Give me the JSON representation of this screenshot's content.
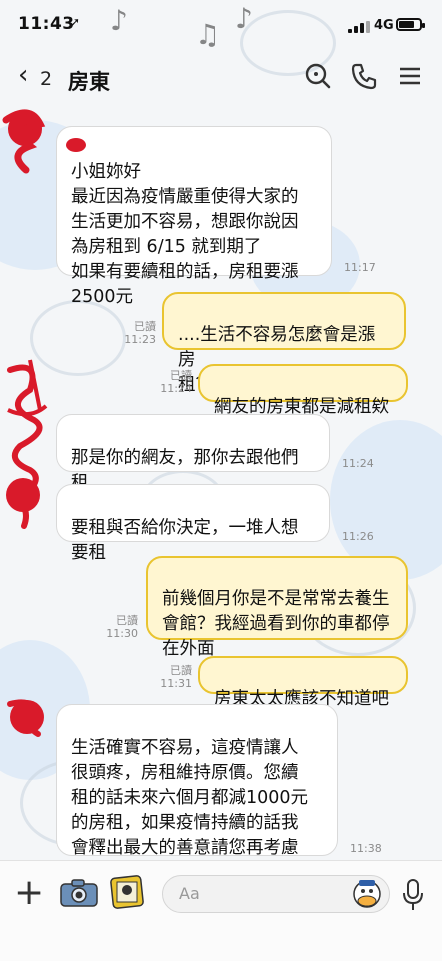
{
  "status": {
    "time": "11:43",
    "network": "4G"
  },
  "header": {
    "back_icon": "chevron-left-icon",
    "unread_count": "2",
    "title": "房東"
  },
  "messages": [
    {
      "text": "小姐妳好\n最近因為疫情嚴重使得大家的\n生活更加不容易，想跟你說因\n為房租到 6/15 就到期了\n如果有要續租的話，房租要漲\n2500元",
      "time": "11:17"
    },
    {
      "text": "....生活不容易怎麼會是漲房\n租？",
      "read": "已讀",
      "time": "11:23"
    },
    {
      "text": "網友的房東都是減租欸",
      "read": "已讀",
      "time": "11:24"
    },
    {
      "text": "那是你的網友，那你去跟他們\n租",
      "time": "11:24"
    },
    {
      "text": "要租與否給你決定，一堆人想\n要租",
      "time": "11:26"
    },
    {
      "text": "前幾個月你是不是常常去養生\n會館？我經過看到你的車都停\n在外面",
      "read": "已讀",
      "time": "11:30"
    },
    {
      "text": "房東太太應該不知道吧",
      "read": "已讀",
      "time": "11:31"
    },
    {
      "text": "生活確實不容易，這疫情讓人\n很頭疼，房租維持原價。您續\n租的話未來六個月都減1000元\n的房租，如果疫情持續的話我\n會釋出最大的善意請您再考慮\n一下",
      "time": "11:38"
    }
  ],
  "input": {
    "placeholder": "Aa"
  },
  "colors": {
    "outgoing_bubble": "#fff6d1",
    "outgoing_border": "#e9c430",
    "redaction": "#d91a2a"
  }
}
